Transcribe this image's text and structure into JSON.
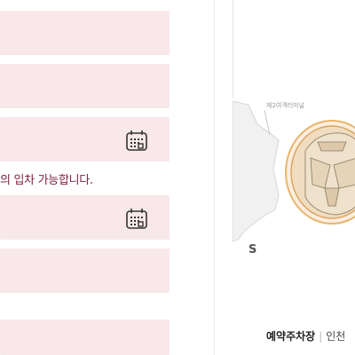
{
  "form": {
    "notice": "의 입차 가능합니다."
  },
  "icons": {
    "calendar": "calendar-icon",
    "map": "terminal-map"
  },
  "map": {
    "terminal_label": "제2여객터미널",
    "compass_label": "S"
  },
  "footer": {
    "title": "예약주차장",
    "separator": "|",
    "subtitle": "인천"
  },
  "colors": {
    "field_bg": "#f8e8ea",
    "notice_text": "#7b1f3a"
  }
}
